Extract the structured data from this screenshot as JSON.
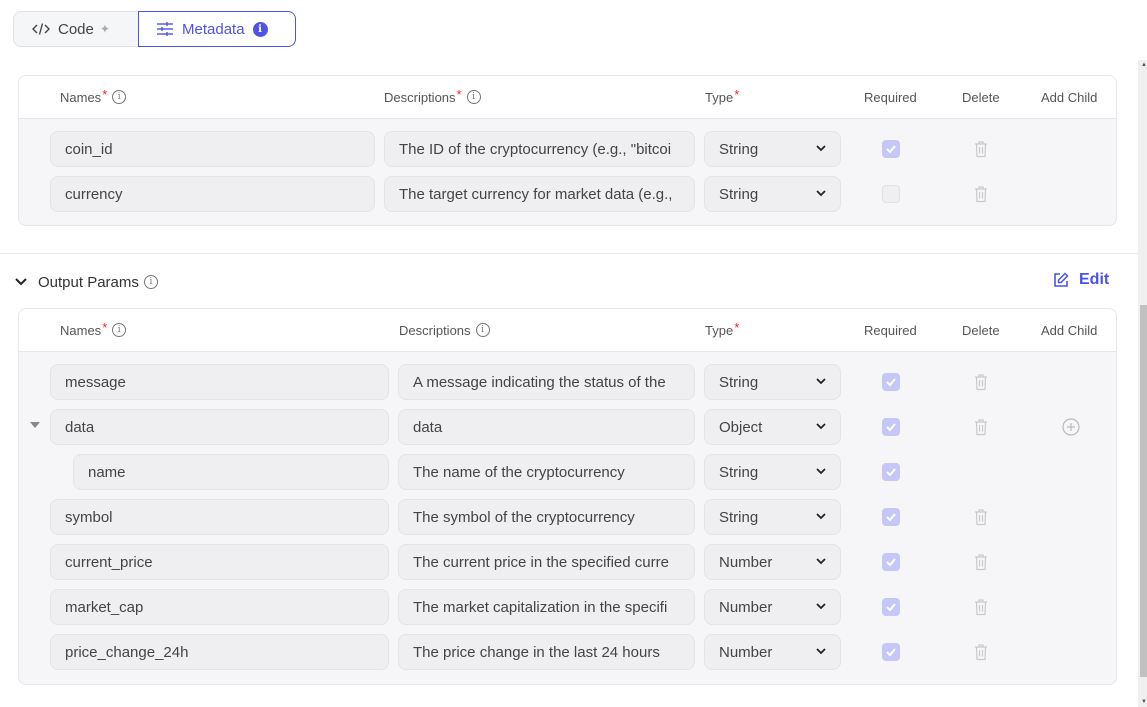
{
  "tabs": [
    {
      "label": "Code",
      "icon": "code-icon",
      "badge_icon": "sparkle-icon",
      "active": false
    },
    {
      "label": "Metadata",
      "icon": "sliders-icon",
      "badge": "i",
      "active": true
    }
  ],
  "colors": {
    "accent": "#4d53e8",
    "required_star": "#f5222d",
    "checkbox_checked": "#c5c7f7"
  },
  "columns": {
    "names": "Names",
    "descriptions": "Descriptions",
    "type": "Type",
    "required": "Required",
    "delete": "Delete",
    "add_child": "Add Child",
    "required_mark": "*",
    "info_glyph": "i"
  },
  "input_params": {
    "rows": [
      {
        "name": "coin_id",
        "description": "The ID of the cryptocurrency (e.g., \"bitcoi",
        "type": "String",
        "required": true
      },
      {
        "name": "currency",
        "description": "The target currency for market data (e.g.,",
        "type": "String",
        "required": false
      }
    ]
  },
  "output_params": {
    "title": "Output Params",
    "edit_label": "Edit",
    "rows": [
      {
        "name": "message",
        "description": "A message indicating the status of the",
        "type": "String",
        "required": true,
        "deletable": true,
        "child": false,
        "expandable": false
      },
      {
        "name": "data",
        "description": "data",
        "type": "Object",
        "required": true,
        "deletable": true,
        "child": false,
        "expandable": true,
        "add_child": true
      },
      {
        "name": "name",
        "description": "The name of the cryptocurrency",
        "type": "String",
        "required": true,
        "deletable": false,
        "child": true
      },
      {
        "name": "symbol",
        "description": "The symbol of the cryptocurrency",
        "type": "String",
        "required": true,
        "deletable": true,
        "child": false
      },
      {
        "name": "current_price",
        "description": "The current price in the specified curre",
        "type": "Number",
        "required": true,
        "deletable": true,
        "child": false
      },
      {
        "name": "market_cap",
        "description": "The market capitalization in the specifi",
        "type": "Number",
        "required": true,
        "deletable": true,
        "child": false
      },
      {
        "name": "price_change_24h",
        "description": "The price change in the last 24 hours",
        "type": "Number",
        "required": true,
        "deletable": true,
        "child": false
      }
    ]
  }
}
